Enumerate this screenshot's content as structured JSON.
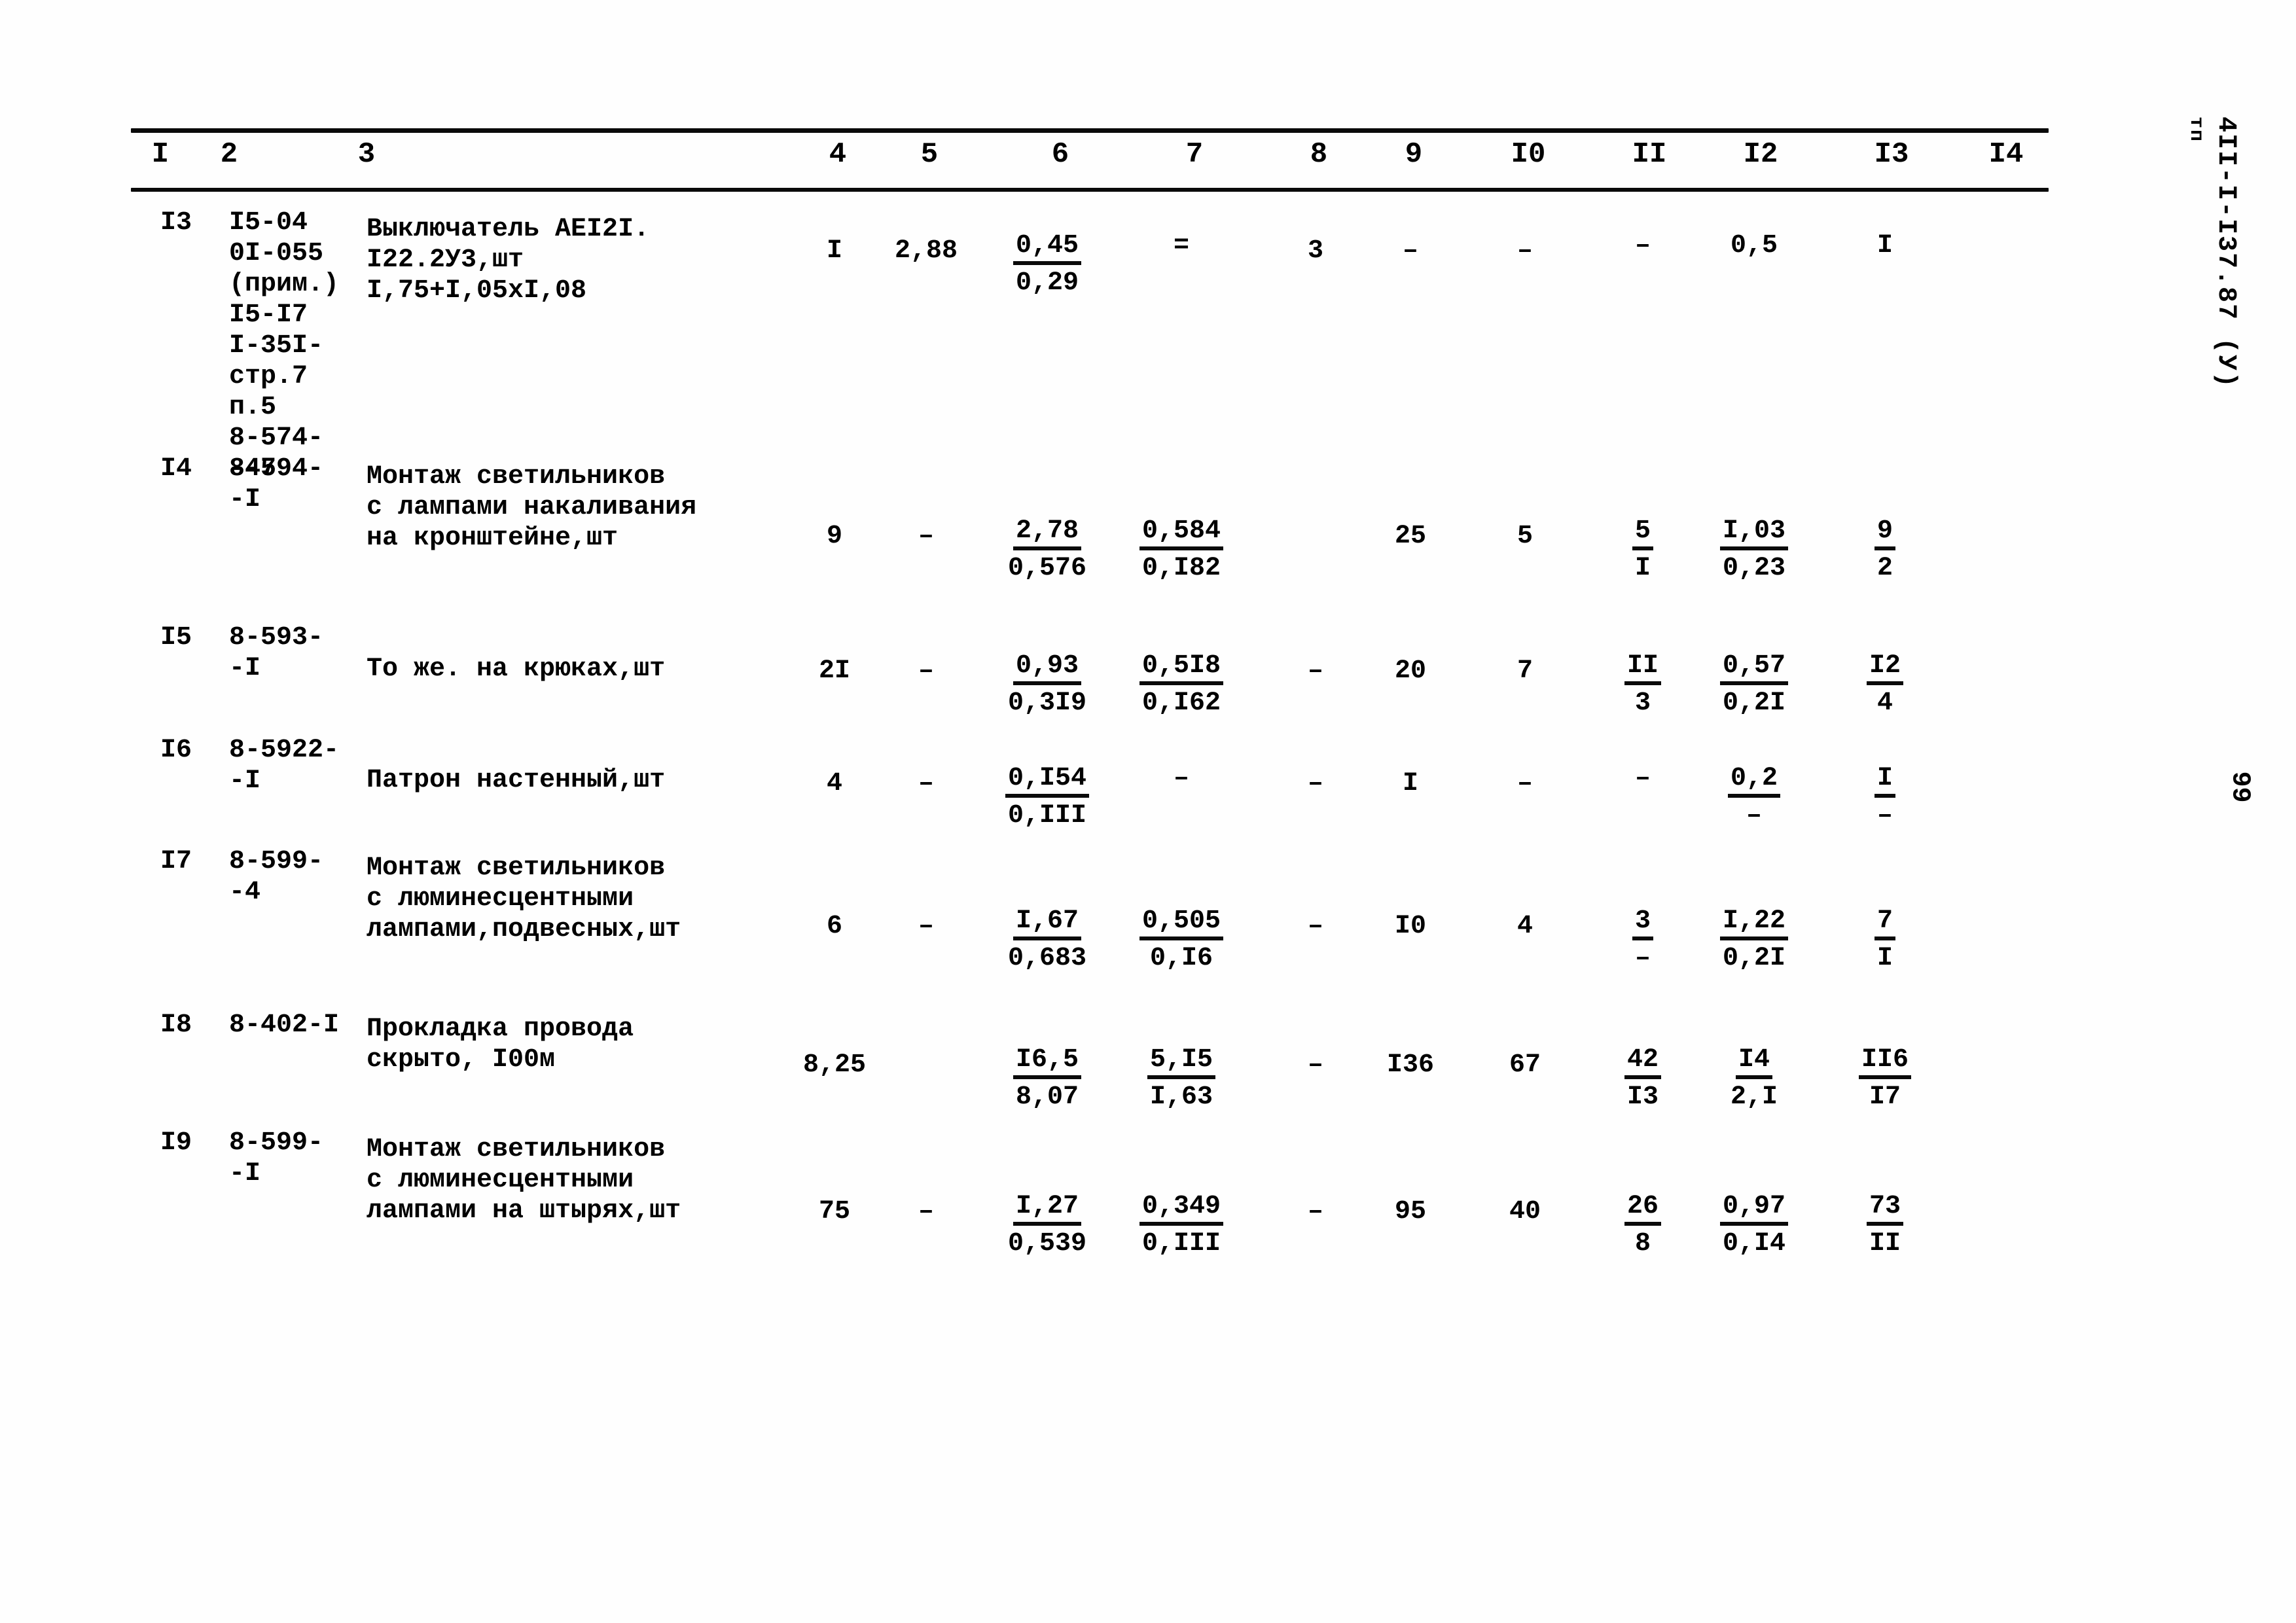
{
  "sidebar": {
    "stamp_prefix": "тп",
    "stamp_code": "4II-I-I37.87  (У)",
    "page_number": "99"
  },
  "table": {
    "column_headers": [
      "I",
      "2",
      "3",
      "4",
      "5",
      "6",
      "7",
      "8",
      "9",
      "I0",
      "II",
      "I2",
      "I3",
      "I4"
    ],
    "rows": [
      {
        "index": "I3",
        "code": "I5-04\n0I-055\n(прим.)\nI5-I7\nI-35I-\nстр.7\nп.5\n8-574-\n-47",
        "description": "Выключатель АЕI2I.\nI22.2У3,шт\nI,75+I,05xI,08",
        "c4": "I",
        "c5": "2,88",
        "c6_top": "0,45",
        "c6_bot": "0,29",
        "c7_top": "=",
        "c7_bot": "",
        "c8": "3",
        "c9": "–",
        "c10": "–",
        "c11_top": "–",
        "c11_bot": "",
        "c12_top": "0,5",
        "c12_bot": "",
        "c13_top": "I",
        "c13_bot": "",
        "c14": ""
      },
      {
        "index": "I4",
        "code": "8-594-\n-I",
        "description": "Монтаж светильников\nс лампами накаливания\nна кронштейне,шт",
        "c4": "9",
        "c5": "–",
        "c6_top": "2,78",
        "c6_bot": "0,576",
        "c7_top": "0,584",
        "c7_bot": "0,I82",
        "c8": "",
        "c9": "25",
        "c10": "5",
        "c11_top": "5",
        "c11_bot": "I",
        "c12_top": "I,03",
        "c12_bot": "0,23",
        "c13_top": "9",
        "c13_bot": "2",
        "c14": ""
      },
      {
        "index": "I5",
        "code": "8-593-\n-I",
        "description": "То же. на крюках,шт",
        "c4": "2I",
        "c5": "–",
        "c6_top": "0,93",
        "c6_bot": "0,3I9",
        "c7_top": "0,5I8",
        "c7_bot": "0,I62",
        "c8": "–",
        "c9": "20",
        "c10": "7",
        "c11_top": "II",
        "c11_bot": "3",
        "c12_top": "0,57",
        "c12_bot": "0,2I",
        "c13_top": "I2",
        "c13_bot": "4",
        "c14": ""
      },
      {
        "index": "I6",
        "code": "8-5922-\n-I",
        "description": "Патрон настенный,шт",
        "c4": "4",
        "c5": "–",
        "c6_top": "0,I54",
        "c6_bot": "0,III",
        "c7_top": "–",
        "c7_bot": "",
        "c8": "–",
        "c9": "I",
        "c10": "–",
        "c11_top": "–",
        "c11_bot": "",
        "c12_top": "0,2",
        "c12_bot": "–",
        "c13_top": "I",
        "c13_bot": "–",
        "c14": ""
      },
      {
        "index": "I7",
        "code": "8-599-\n-4",
        "description": "Монтаж светильников\nс люминесцентными\nлампами,подвесных,шт",
        "c4": "6",
        "c5": "–",
        "c6_top": "I,67",
        "c6_bot": "0,683",
        "c7_top": "0,505",
        "c7_bot": "0,I6",
        "c8": "–",
        "c9": "I0",
        "c10": "4",
        "c11_top": "3",
        "c11_bot": "–",
        "c12_top": "I,22",
        "c12_bot": "0,2I",
        "c13_top": "7",
        "c13_bot": "I",
        "c14": ""
      },
      {
        "index": "I8",
        "code": "8-402-I",
        "description": "Прокладка провода\nскрыто, I00м",
        "c4": "8,25",
        "c5": "",
        "c6_top": "I6,5",
        "c6_bot": "8,07",
        "c7_top": "5,I5",
        "c7_bot": "I,63",
        "c8": "–",
        "c9": "I36",
        "c10": "67",
        "c11_top": "42",
        "c11_bot": "I3",
        "c12_top": "I4",
        "c12_bot": "2,I",
        "c13_top": "II6",
        "c13_bot": "I7",
        "c14": ""
      },
      {
        "index": "I9",
        "code": "8-599-\n-I",
        "description": "Монтаж светильников\nс люминесцентными\nлампами на штырях,шт",
        "c4": "75",
        "c5": "–",
        "c6_top": "I,27",
        "c6_bot": "0,539",
        "c7_top": "0,349",
        "c7_bot": "0,III",
        "c8": "–",
        "c9": "95",
        "c10": "40",
        "c11_top": "26",
        "c11_bot": "8",
        "c12_top": "0,97",
        "c12_bot": "0,I4",
        "c13_top": "73",
        "c13_bot": "II",
        "c14": ""
      }
    ]
  }
}
